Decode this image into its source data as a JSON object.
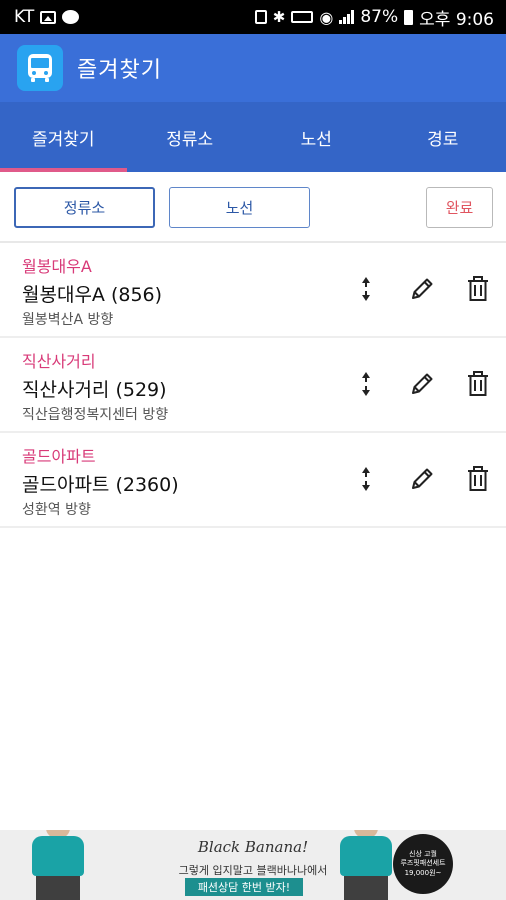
{
  "status_bar": {
    "carrier": "KT",
    "battery_percent": "87%",
    "time": "오후 9:06",
    "icons": [
      "image-icon",
      "message-icon",
      "lock-icon",
      "bluetooth-icon",
      "vibrate-icon",
      "wifi-icon",
      "signal-icon",
      "battery-icon"
    ]
  },
  "app_bar": {
    "title": "즐겨찾기",
    "icon": "bus-icon"
  },
  "tabs": [
    {
      "label": "즐겨찾기",
      "active": true
    },
    {
      "label": "정류소",
      "active": false
    },
    {
      "label": "노선",
      "active": false
    },
    {
      "label": "경로",
      "active": false
    }
  ],
  "filter": {
    "stop_label": "정류소",
    "route_label": "노선",
    "done_label": "완료",
    "selected": "정류소"
  },
  "favorites": [
    {
      "title": "월봉대우A",
      "name": "월봉대우A (856)",
      "direction": "월봉벽산A 방향"
    },
    {
      "title": "직산사거리",
      "name": "직산사거리 (529)",
      "direction": "직산읍행정복지센터 방향"
    },
    {
      "title": "골드아파트",
      "name": "골드아파트 (2360)",
      "direction": "성환역 방향"
    }
  ],
  "item_actions": [
    "reorder-icon",
    "edit-icon",
    "delete-icon"
  ],
  "ad": {
    "brand": "Black Banana!",
    "line1": "그렇게 입지말고 블랙바나나에서",
    "line2": "패션상담 한번 받자!",
    "badge_line1": "신상 고퀄",
    "badge_line2": "루즈핏패션세트",
    "badge_price": "19,000원~"
  },
  "colors": {
    "app_bar": "#3a6fd8",
    "tab_bar": "#3465c7",
    "tab_indicator": "#e05a8a",
    "item_title": "#d83a78",
    "done_text": "#e05560"
  }
}
